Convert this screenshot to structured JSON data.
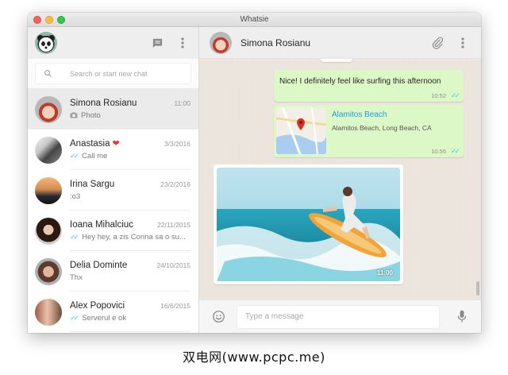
{
  "window": {
    "title": "Whatsie"
  },
  "sidebar": {
    "search_placeholder": "Search or start new chat",
    "chats": [
      {
        "name": "Simona Rosianu",
        "time": "11:00",
        "preview": "Photo",
        "preview_icon": "camera-icon",
        "ticks": false,
        "heart": false,
        "active": true
      },
      {
        "name": "Anastasia",
        "time": "3/3/2016",
        "preview": "Call me",
        "ticks": true,
        "heart": true,
        "active": false
      },
      {
        "name": "Irina Sargu",
        "time": "23/2/2016",
        "preview": ":o3",
        "ticks": false,
        "heart": false,
        "active": false
      },
      {
        "name": "Ioana Mihalciuc",
        "time": "22/11/2015",
        "preview": "Hey hey, a zis Corina sa o su...",
        "ticks": true,
        "heart": false,
        "active": false
      },
      {
        "name": "Delia Dominte",
        "time": "24/10/2015",
        "preview": "Thx",
        "ticks": false,
        "heart": false,
        "active": false
      },
      {
        "name": "Alex Popovici",
        "time": "16/6/2015",
        "preview": "Serverul e ok",
        "ticks": true,
        "heart": false,
        "active": false
      }
    ],
    "heart_glyph": "❤",
    "ticks_glyph": "✓✓"
  },
  "conversation": {
    "contact_name": "Simona Rosianu",
    "messages": {
      "surf": {
        "text": "Nice! I definitely feel like surfing this afternoon",
        "time": "10:52"
      },
      "location": {
        "title": "Alamitos Beach",
        "address": "Alamitos Beach, Long Beach, CA",
        "time": "10:55"
      },
      "photo": {
        "time": "11:00"
      }
    },
    "input_placeholder": "Type a message"
  },
  "colors": {
    "accent_blue": "#1e9be9",
    "tick_blue": "#4fc3f7",
    "outgoing_bubble": "#dcf8c6",
    "chat_background": "#ece5dd"
  },
  "watermark": "双电网(www.pcpc.me)"
}
